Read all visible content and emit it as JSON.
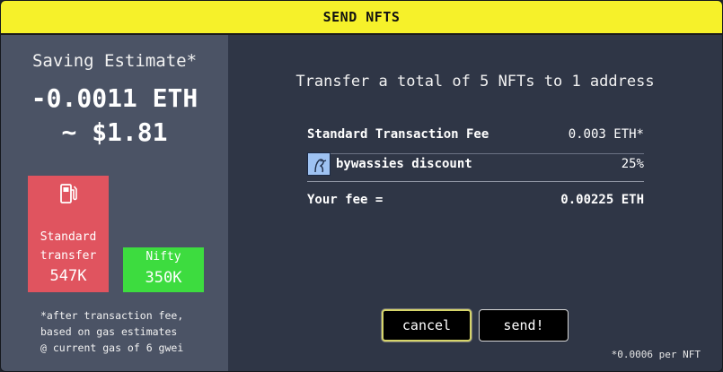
{
  "dialog": {
    "title": "SEND NFTS"
  },
  "left_panel": {
    "saving_title": "Saving Estimate*",
    "eth_saving": "-0.0011 ETH",
    "usd_saving": "~ $1.81",
    "bars": [
      {
        "label_line1": "Standard",
        "label_line2": "transfer",
        "value": "547K",
        "color": "#e0545f",
        "icon": "gas-pump-icon"
      },
      {
        "label": "Nifty",
        "value": "350K",
        "color": "#3ddc3f"
      }
    ],
    "footnote_lines": [
      "*after transaction fee,",
      "based on gas estimates",
      "@ current gas of 6 gwei"
    ]
  },
  "right_panel": {
    "heading": "Transfer a total of 5 NFTs to 1 address",
    "fees": {
      "standard_label": "Standard Transaction Fee",
      "standard_value": "0.003 ETH*",
      "discount_label": "bywassies discount",
      "discount_value": "25%",
      "your_fee_label": "Your fee =",
      "your_fee_value": "0.00225 ETH"
    },
    "buttons": {
      "cancel": "cancel",
      "send": "send!"
    },
    "per_nft_note": "*0.0006 per NFT"
  },
  "colors": {
    "title_bar": "#f6f12a",
    "left_bg": "#4b5365",
    "right_bg": "#2f3646",
    "standard_bar": "#e0545f",
    "nifty_bar": "#3ddc3f"
  }
}
